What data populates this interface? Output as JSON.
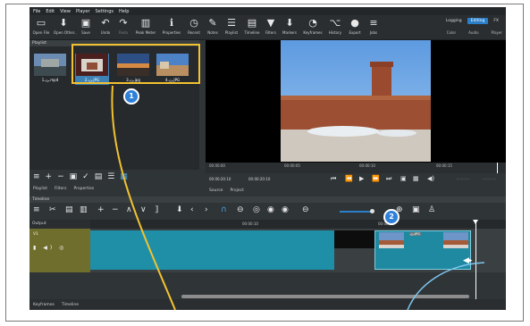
{
  "menu": [
    "File",
    "Edit",
    "View",
    "Player",
    "Settings",
    "Help"
  ],
  "toolbar": [
    {
      "icon": "folder-icon",
      "glyph": "▭",
      "label": "Open File"
    },
    {
      "icon": "open-other-icon",
      "glyph": "⬇",
      "label": "Open Other.."
    },
    {
      "icon": "save-icon",
      "glyph": "💾",
      "label": "Save"
    },
    {
      "icon": "undo-icon",
      "glyph": "↶",
      "label": "Undo"
    },
    {
      "icon": "redo-icon",
      "glyph": "↷",
      "label": "Redo"
    },
    {
      "icon": "peak-meter-icon",
      "glyph": "▥",
      "label": "Peak Meter"
    },
    {
      "icon": "properties-icon",
      "glyph": "ℹ",
      "label": "Properties"
    },
    {
      "icon": "recent-icon",
      "glyph": "◷",
      "label": "Recent"
    },
    {
      "icon": "notes-icon",
      "glyph": "✎",
      "label": "Notes"
    },
    {
      "icon": "playlist-icon",
      "glyph": "☰",
      "label": "Playlist"
    },
    {
      "icon": "timeline-icon",
      "glyph": "▤",
      "label": "Timeline"
    },
    {
      "icon": "filters-icon",
      "glyph": "▼",
      "label": "Filters"
    },
    {
      "icon": "markers-icon",
      "glyph": "⬇",
      "label": "Markers"
    },
    {
      "icon": "keyframes-icon",
      "glyph": "◔",
      "label": "Keyframes"
    },
    {
      "icon": "history-icon",
      "glyph": "⌥",
      "label": "History"
    },
    {
      "icon": "export-icon",
      "glyph": "●",
      "label": "Export"
    },
    {
      "icon": "jobs-icon",
      "glyph": "≡",
      "label": "Jobs"
    }
  ],
  "layouts": [
    "Logging",
    "Editing",
    "FX"
  ],
  "layout_sub": [
    "Color",
    "Audio",
    "Player"
  ],
  "playlist": {
    "title": "Playlist",
    "items": [
      {
        "caption": "1.ﺊﯾ.mp4"
      },
      {
        "caption": "2.ﺊﯾ.JPG"
      },
      {
        "caption": "3.ﺊﯾ.jpg"
      },
      {
        "caption": "4.ﺊﯾ.JPG"
      }
    ],
    "tabs": [
      "Playlist",
      "Filters",
      "Properties"
    ]
  },
  "badges": {
    "one": "1",
    "two": "2"
  },
  "viewer": {
    "ruler_ticks": [
      "00:00:00",
      "00:00:05",
      "00:00:10",
      "00:00:15"
    ],
    "timecode_current": "00:00:20:10",
    "timecode_total": "00:00:20:10",
    "source_tabs": [
      "Source",
      "Project"
    ],
    "right_timecodes": [
      "--:--:--:--",
      "--:--:--:--"
    ]
  },
  "timeline": {
    "title": "Timeline",
    "output_label": "Output",
    "track_name": "V1",
    "ruler_ticks": [
      "00:00:10",
      "00:00:15"
    ],
    "clip_label_1": "ﺊﯾ.mp4",
    "clip_label_2": "ﺊﯾ.JPG",
    "bottom_tabs": [
      "Keyframes",
      "Timeline"
    ]
  },
  "colors": {
    "accent": "#2b7fc9",
    "highlight": "#f2c230",
    "clip": "#1f8fa8",
    "track_head": "#6f6e2c"
  }
}
